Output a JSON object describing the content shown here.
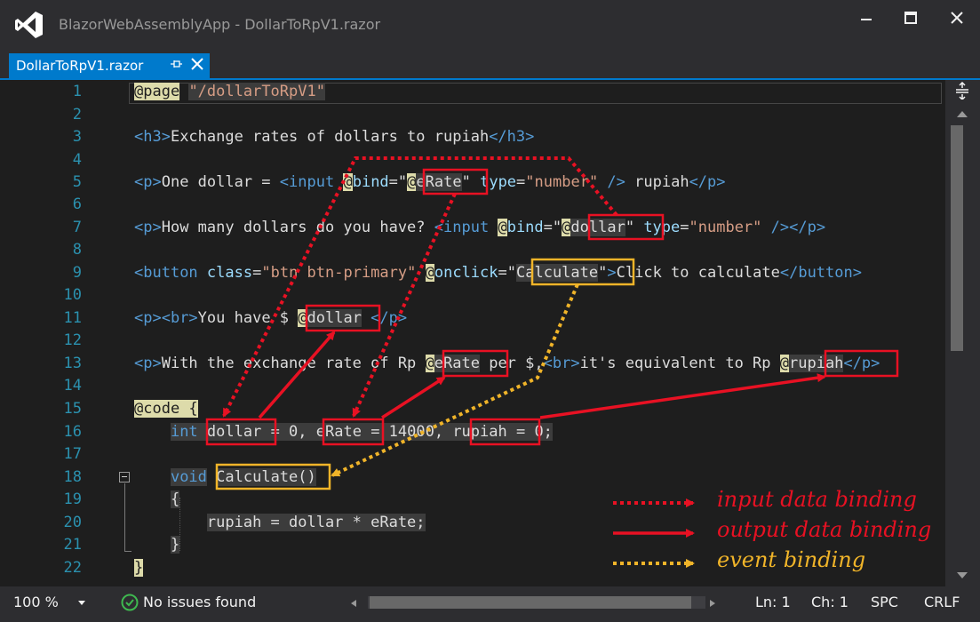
{
  "window": {
    "title": "BlazorWebAssemblyApp - DollarToRpV1.razor"
  },
  "tab": {
    "label": "DollarToRpV1.razor"
  },
  "editor": {
    "line_numbers": [
      "1",
      "2",
      "3",
      "4",
      "5",
      "6",
      "7",
      "8",
      "9",
      "10",
      "11",
      "12",
      "13",
      "14",
      "15",
      "16",
      "17",
      "18",
      "19",
      "20",
      "21",
      "22"
    ],
    "lines": {
      "l1": {
        "page": "@page",
        "route": "\"/dollarToRpV1\""
      },
      "l3": {
        "open": "<h3>",
        "text": "Exchange rates of dollars to rupiah",
        "close": "</h3>"
      },
      "l5": {
        "p": "<p>",
        "text1": "One dollar = ",
        "lt": "<",
        "input": "input",
        "at": "@",
        "bind": "bind",
        "eq": "=\"",
        "ref": "eRate",
        "q": "\"",
        "type": "type",
        "typeval": "\"number\"",
        "selfclose": " />",
        "text2": " rupiah",
        "pclose": "</p>"
      },
      "l7": {
        "p": "<p>",
        "text1": "How many dollars do you have? ",
        "lt": "<",
        "input": "input",
        "at": "@",
        "bind": "bind",
        "eq": "=\"",
        "ref": "dollar",
        "q": "\"",
        "type": "type",
        "typeval": "\"number\"",
        "selfclose": " />",
        "pclose": "</p>"
      },
      "l9": {
        "lt": "<",
        "button": "button",
        "class": "class",
        "classval": "\"btn btn-primary\"",
        "at": "@",
        "onclick": "onclick",
        "eq": "=\"",
        "ref": "Calculate",
        "q": "\"",
        "gt": ">",
        "text": "Click to calculate",
        "close": "</button>"
      },
      "l11": {
        "p": "<p>",
        "br": "<br>",
        "text": "You have $ ",
        "at": "@",
        "ref": "dollar",
        "pclose": " </p>"
      },
      "l13": {
        "p": "<p>",
        "text1": "With the exchange rate of Rp ",
        "at": "@",
        "ref1": "eRate",
        "text2": " per $,",
        "br": "<br>",
        "text3": "it's equivalent to Rp ",
        "ref2": "rupiah",
        "pclose": "</p>"
      },
      "l15": {
        "code": "@code",
        "brace": " {"
      },
      "l16": {
        "int": "int",
        "dollar": "dollar",
        "eq0": " = 0, ",
        "erate": "eRate",
        "eq1": " = 14000, ",
        "rupiah": "rupiah",
        "eq2": " = 0;"
      },
      "l18": {
        "void": "void",
        "calc": "Calculate()"
      },
      "l19": {
        "brace": "{"
      },
      "l20": {
        "stmt": "rupiah = dollar * eRate;"
      },
      "l21": {
        "brace": "}"
      },
      "l22": {
        "brace": "}"
      }
    }
  },
  "legend": {
    "input": "input data binding",
    "output": "output data binding",
    "event": "event binding"
  },
  "statusbar": {
    "zoom": "100 %",
    "issues": "No issues found",
    "ln": "Ln: 1",
    "ch": "Ch: 1",
    "spc": "SPC",
    "crlf": "CRLF"
  },
  "icons": [
    "vs-logo-icon",
    "minimize-icon",
    "maximize-icon",
    "close-icon",
    "pin-icon",
    "tab-close-icon",
    "dropdown-icon",
    "gear-icon",
    "check-circle-icon",
    "collapse-icon"
  ],
  "colors": {
    "accent": "#007acc",
    "input_binding": "#e81123",
    "output_binding": "#ff0000",
    "event_binding": "#f0b429"
  }
}
